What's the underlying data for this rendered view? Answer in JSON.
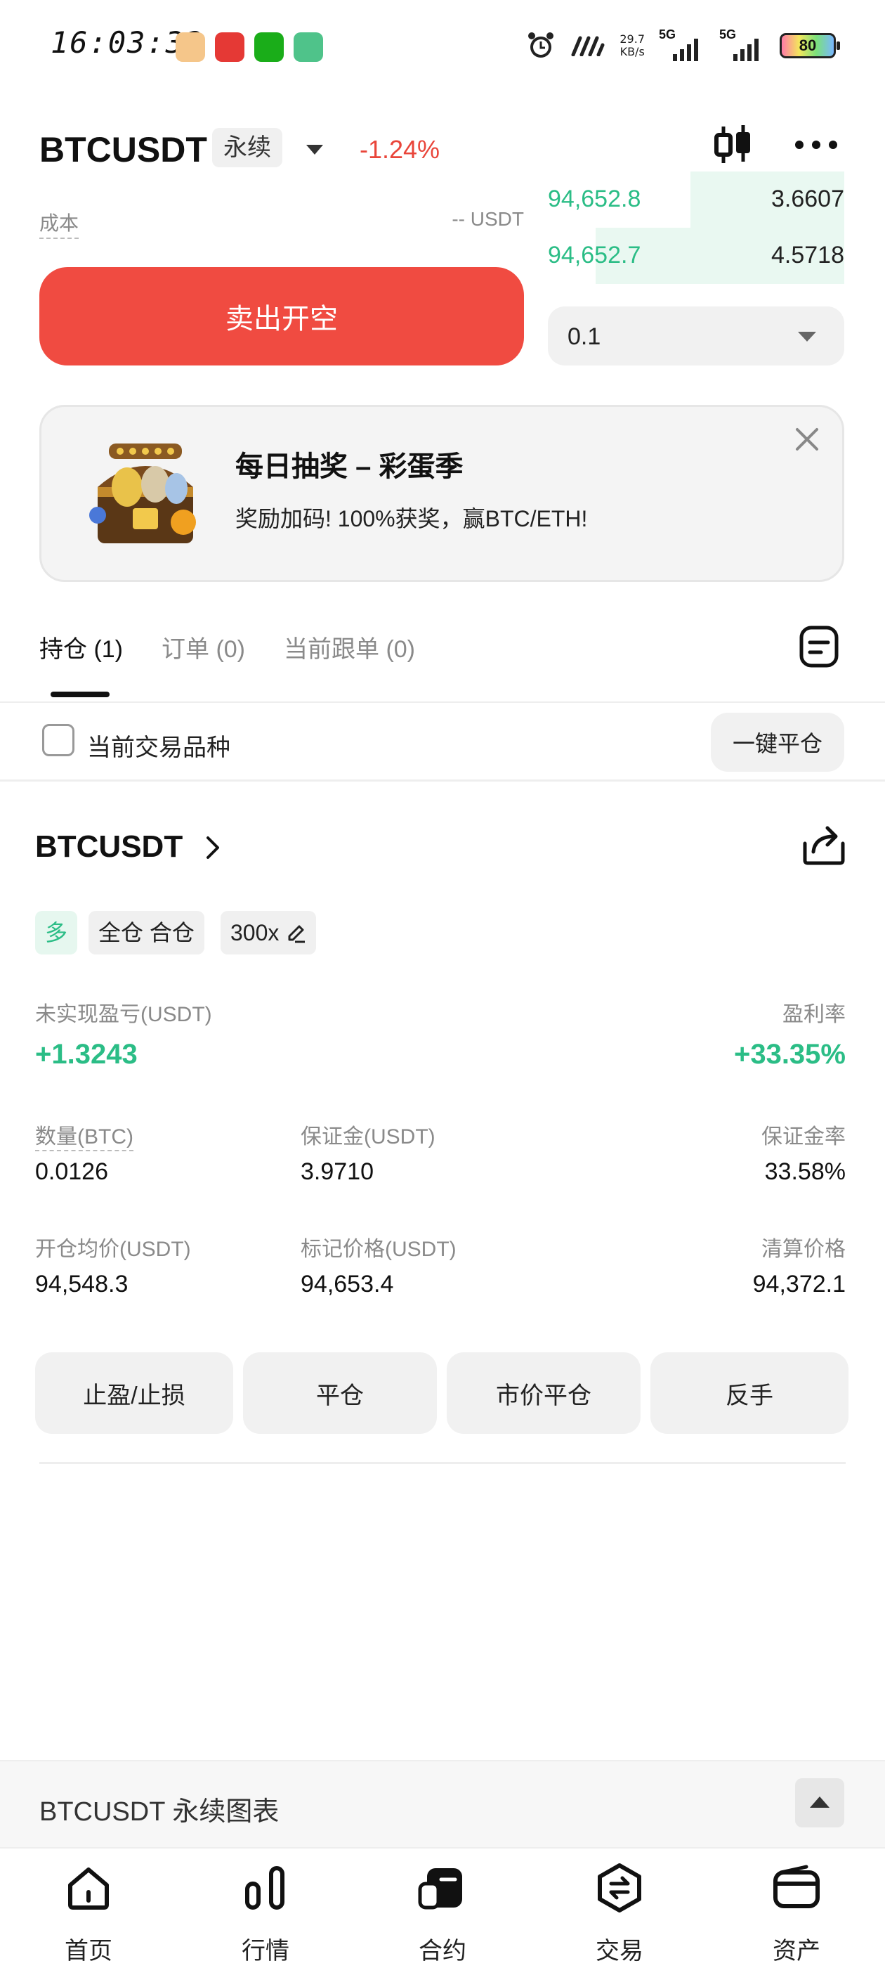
{
  "status": {
    "time": "16:03:32",
    "net_speed_value": "29.7",
    "net_speed_unit": "KB/s",
    "network_1": "5G",
    "network_2": "5G",
    "battery": "80"
  },
  "header": {
    "pair": "BTCUSDT",
    "contract_type": "永续",
    "change": "-1.24%"
  },
  "order_form": {
    "cost_label": "成本",
    "cost_value": "-- USDT",
    "sell_button": "卖出开空"
  },
  "order_book": {
    "rows": [
      {
        "price": "94,652.8",
        "qty": "3.6607",
        "depth": 0.52
      },
      {
        "price": "94,652.7",
        "qty": "4.5718",
        "depth": 0.84
      }
    ],
    "quantity_select": "0.1"
  },
  "promo": {
    "title": "每日抽奖 – 彩蛋季",
    "desc": "奖励加码! 100%获奖，赢BTC/ETH!"
  },
  "tabs": [
    {
      "label": "持仓 (1)",
      "active": true
    },
    {
      "label": "订单 (0)",
      "active": false
    },
    {
      "label": "当前跟单 (0)",
      "active": false
    }
  ],
  "filter": {
    "label": "当前交易品种",
    "close_all": "一键平仓"
  },
  "position": {
    "symbol": "BTCUSDT",
    "side_tag": "多",
    "mode_tag": "全仓 合仓",
    "leverage_tag": "300x",
    "unrealized_label": "未实现盈亏(USDT)",
    "unrealized_value": "+1.3243",
    "roe_label": "盈利率",
    "roe_value": "+33.35%",
    "qty_label": "数量(BTC)",
    "qty_value": "0.0126",
    "margin_label": "保证金(USDT)",
    "margin_value": "3.9710",
    "margin_ratio_label": "保证金率",
    "margin_ratio_value": "33.58%",
    "entry_label": "开仓均价(USDT)",
    "entry_value": "94,548.3",
    "mark_label": "标记价格(USDT)",
    "mark_value": "94,653.4",
    "liq_label": "清算价格",
    "liq_value": "94,372.1"
  },
  "actions": {
    "tpsl": "止盈/止损",
    "close": "平仓",
    "market_close": "市价平仓",
    "reverse": "反手"
  },
  "chart_bar": {
    "label": "BTCUSDT 永续图表"
  },
  "nav": {
    "home": "首页",
    "markets": "行情",
    "futures": "合约",
    "trade": "交易",
    "assets": "资产"
  },
  "colors": {
    "sell_red": "#f04b41",
    "buy_green": "#2bbd86",
    "change_red": "#e9453a"
  }
}
